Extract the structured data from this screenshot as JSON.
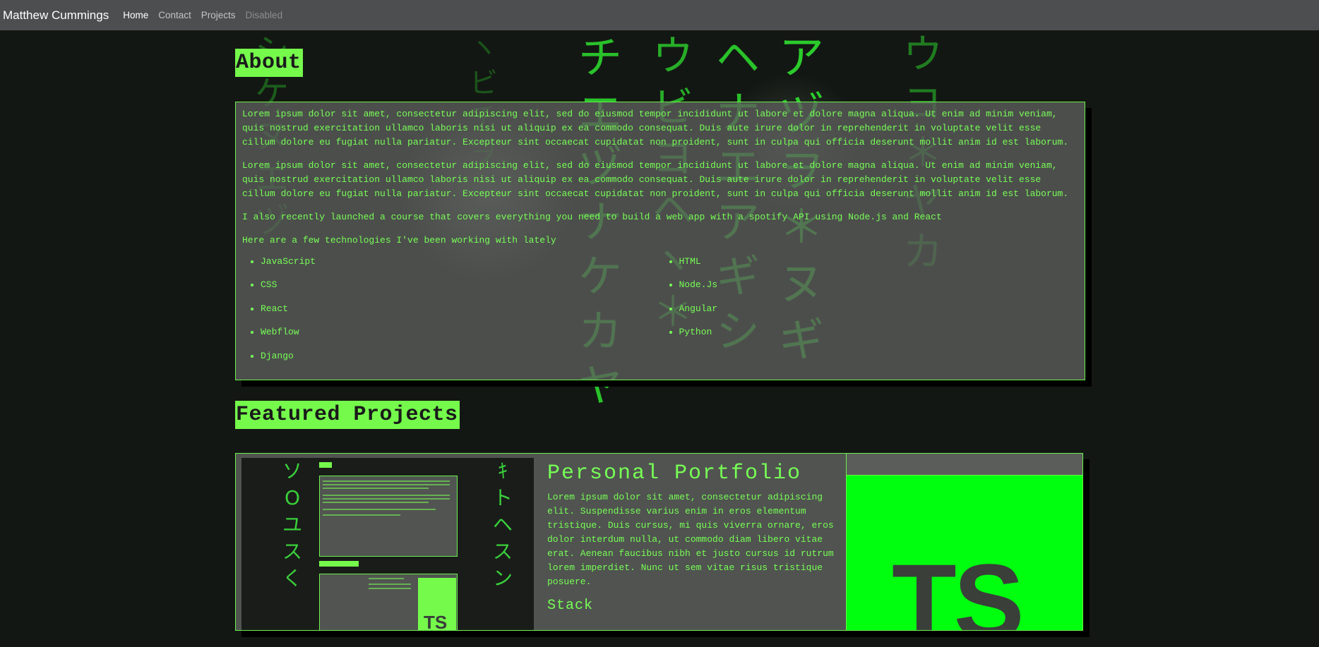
{
  "navbar": {
    "brand": "Matthew Cummings",
    "links": [
      {
        "label": "Home",
        "state": "active"
      },
      {
        "label": "Contact",
        "state": "normal"
      },
      {
        "label": "Projects",
        "state": "normal"
      },
      {
        "label": "Disabled",
        "state": "disabled"
      }
    ]
  },
  "about": {
    "heading": "About",
    "paragraphs": [
      "Lorem ipsum dolor sit amet, consectetur adipiscing elit, sed do eiusmod tempor incididunt ut labore et dolore magna aliqua. Ut enim ad minim veniam, quis nostrud exercitation ullamco laboris nisi ut aliquip ex ea commodo consequat. Duis aute irure dolor in reprehenderit in voluptate velit esse cillum dolore eu fugiat nulla pariatur. Excepteur sint occaecat cupidatat non proident, sunt in culpa qui officia deserunt mollit anim id est laborum.",
      "Lorem ipsum dolor sit amet, consectetur adipiscing elit, sed do eiusmod tempor incididunt ut labore et dolore magna aliqua. Ut enim ad minim veniam, quis nostrud exercitation ullamco laboris nisi ut aliquip ex ea commodo consequat. Duis aute irure dolor in reprehenderit in voluptate velit esse cillum dolore eu fugiat nulla pariatur. Excepteur sint occaecat cupidatat non proident, sunt in culpa qui officia deserunt mollit anim id est laborum.",
      "I also recently launched a course that covers everything you need to build a web app with a spotify API using Node.js and React",
      "Here are a few technologies I've been working with lately"
    ],
    "tech_left": [
      "JavaScript",
      "CSS",
      "React",
      "Webflow",
      "Django"
    ],
    "tech_right": [
      "HTML",
      "Node.Js",
      "Angular",
      "Python"
    ]
  },
  "projects": {
    "heading": "Featured Projects",
    "items": [
      {
        "title": "Personal Portfolio",
        "description": "Lorem ipsum dolor sit amet, consectetur adipiscing elit. Suspendisse varius enim in eros elementum tristique. Duis cursus, mi quis viverra ornare, eros dolor interdum nulla, ut commodo diam libero vitae erat. Aenean faucibus nibh et justo cursus id rutrum lorem imperdiet. Nunc ut sem vitae risus tristique posuere.",
        "stack_label": "Stack",
        "logo_text": "TS"
      }
    ]
  },
  "colors": {
    "accent": "#75fa4c",
    "text_green": "#77ff55",
    "navbar_bg": "#4d4e50",
    "page_bg": "#131713",
    "card_bg": "#5c5e5c",
    "logo_bg": "#00ff0f"
  },
  "background_glyphs": [
    "チ",
    "ウ",
    "エ",
    "ヘ",
    "ア",
    "ヅ",
    "ナ",
    "ビ",
    "ヨ",
    "ケ",
    "カ",
    "ヽ",
    "＊",
    "ギ",
    "ヲ",
    "ヤ",
    "シ",
    "ヌ"
  ]
}
